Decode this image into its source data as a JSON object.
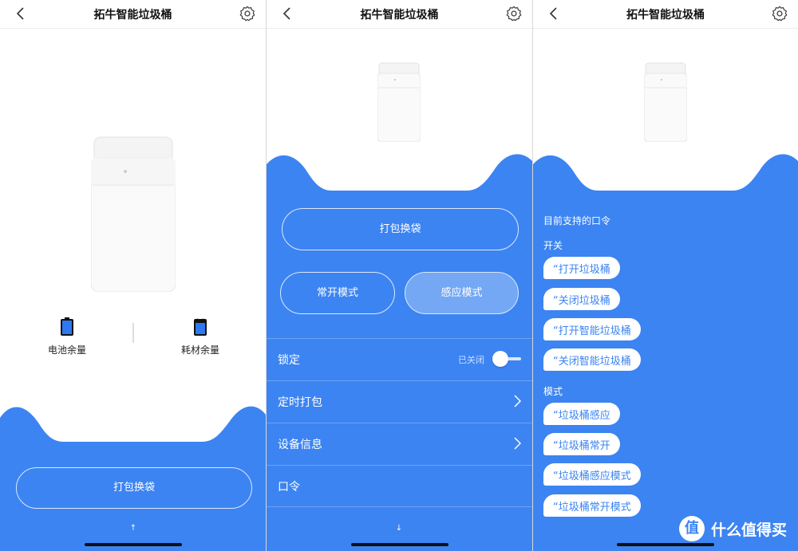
{
  "title": "拓牛智能垃圾桶",
  "colors": {
    "accent": "#3c84f1",
    "chip_text": "#3c84f1"
  },
  "screen1": {
    "battery_label": "电池余量",
    "consumable_label": "耗材余量",
    "pack_button": "打包换袋",
    "arrow": "↑"
  },
  "screen2": {
    "pack_button": "打包换袋",
    "mode_open": "常开模式",
    "mode_sense": "感应模式",
    "rows": [
      {
        "label": "锁定",
        "status": "已关闭"
      },
      {
        "label": "定时打包"
      },
      {
        "label": "设备信息"
      },
      {
        "label": "口令"
      }
    ],
    "arrow": "↓"
  },
  "screen3": {
    "heading": "目前支持的口令",
    "groups": [
      {
        "name": "开关",
        "commands": [
          "“打开垃圾桶",
          "“关闭垃圾桶",
          "“打开智能垃圾桶",
          "“关闭智能垃圾桶"
        ]
      },
      {
        "name": "模式",
        "commands": [
          "“垃圾桶感应",
          "“垃圾桶常开",
          "“垃圾桶感应模式",
          "“垃圾桶常开模式"
        ]
      }
    ],
    "watermark_logo": "值",
    "watermark_text": "什么值得买"
  }
}
